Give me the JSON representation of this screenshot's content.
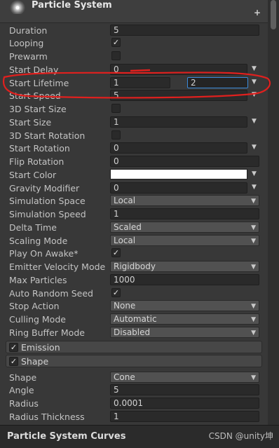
{
  "header": {
    "title": "Particle System",
    "add_icon": "plus-icon"
  },
  "rows": {
    "duration": {
      "label": "Duration",
      "value": "5"
    },
    "looping": {
      "label": "Looping",
      "checked": true
    },
    "prewarm": {
      "label": "Prewarm",
      "checked": false
    },
    "start_delay": {
      "label": "Start Delay",
      "value": "0"
    },
    "start_lifetime": {
      "label": "Start Lifetime",
      "min": "1",
      "max": "2"
    },
    "start_speed": {
      "label": "Start Speed",
      "value": "5"
    },
    "start_size_3d": {
      "label": "3D Start Size",
      "checked": false
    },
    "start_size": {
      "label": "Start Size",
      "value": "1"
    },
    "start_rotation_3d": {
      "label": "3D Start Rotation",
      "checked": false
    },
    "start_rotation": {
      "label": "Start Rotation",
      "value": "0"
    },
    "flip_rotation": {
      "label": "Flip Rotation",
      "value": "0"
    },
    "start_color": {
      "label": "Start Color",
      "color": "#ffffff"
    },
    "gravity_modifier": {
      "label": "Gravity Modifier",
      "value": "0"
    },
    "simulation_space": {
      "label": "Simulation Space",
      "value": "Local"
    },
    "simulation_speed": {
      "label": "Simulation Speed",
      "value": "1"
    },
    "delta_time": {
      "label": "Delta Time",
      "value": "Scaled"
    },
    "scaling_mode": {
      "label": "Scaling Mode",
      "value": "Local"
    },
    "play_on_awake": {
      "label": "Play On Awake*",
      "checked": true
    },
    "emitter_velocity_mode": {
      "label": "Emitter Velocity Mode",
      "value": "Rigidbody"
    },
    "max_particles": {
      "label": "Max Particles",
      "value": "1000"
    },
    "auto_random_seed": {
      "label": "Auto Random Seed",
      "checked": true
    },
    "stop_action": {
      "label": "Stop Action",
      "value": "None"
    },
    "culling_mode": {
      "label": "Culling Mode",
      "value": "Automatic"
    },
    "ring_buffer_mode": {
      "label": "Ring Buffer Mode",
      "value": "Disabled"
    }
  },
  "sections": {
    "emission": {
      "label": "Emission",
      "checked": true
    },
    "shape": {
      "label": "Shape",
      "checked": true
    }
  },
  "shape_rows": {
    "shape": {
      "label": "Shape",
      "value": "Cone"
    },
    "angle": {
      "label": "Angle",
      "value": "5"
    },
    "radius": {
      "label": "Radius",
      "value": "0.0001"
    },
    "radius_thickness": {
      "label": "Radius Thickness",
      "value": "1"
    }
  },
  "footer": {
    "title": "Particle System Curves",
    "watermark": "CSDN @unity坤"
  },
  "colors": {
    "background": "#383838",
    "field": "#2a2a2a",
    "dropdown": "#515151",
    "highlight": "#3b8ad9",
    "annotation": "#e0201e"
  }
}
